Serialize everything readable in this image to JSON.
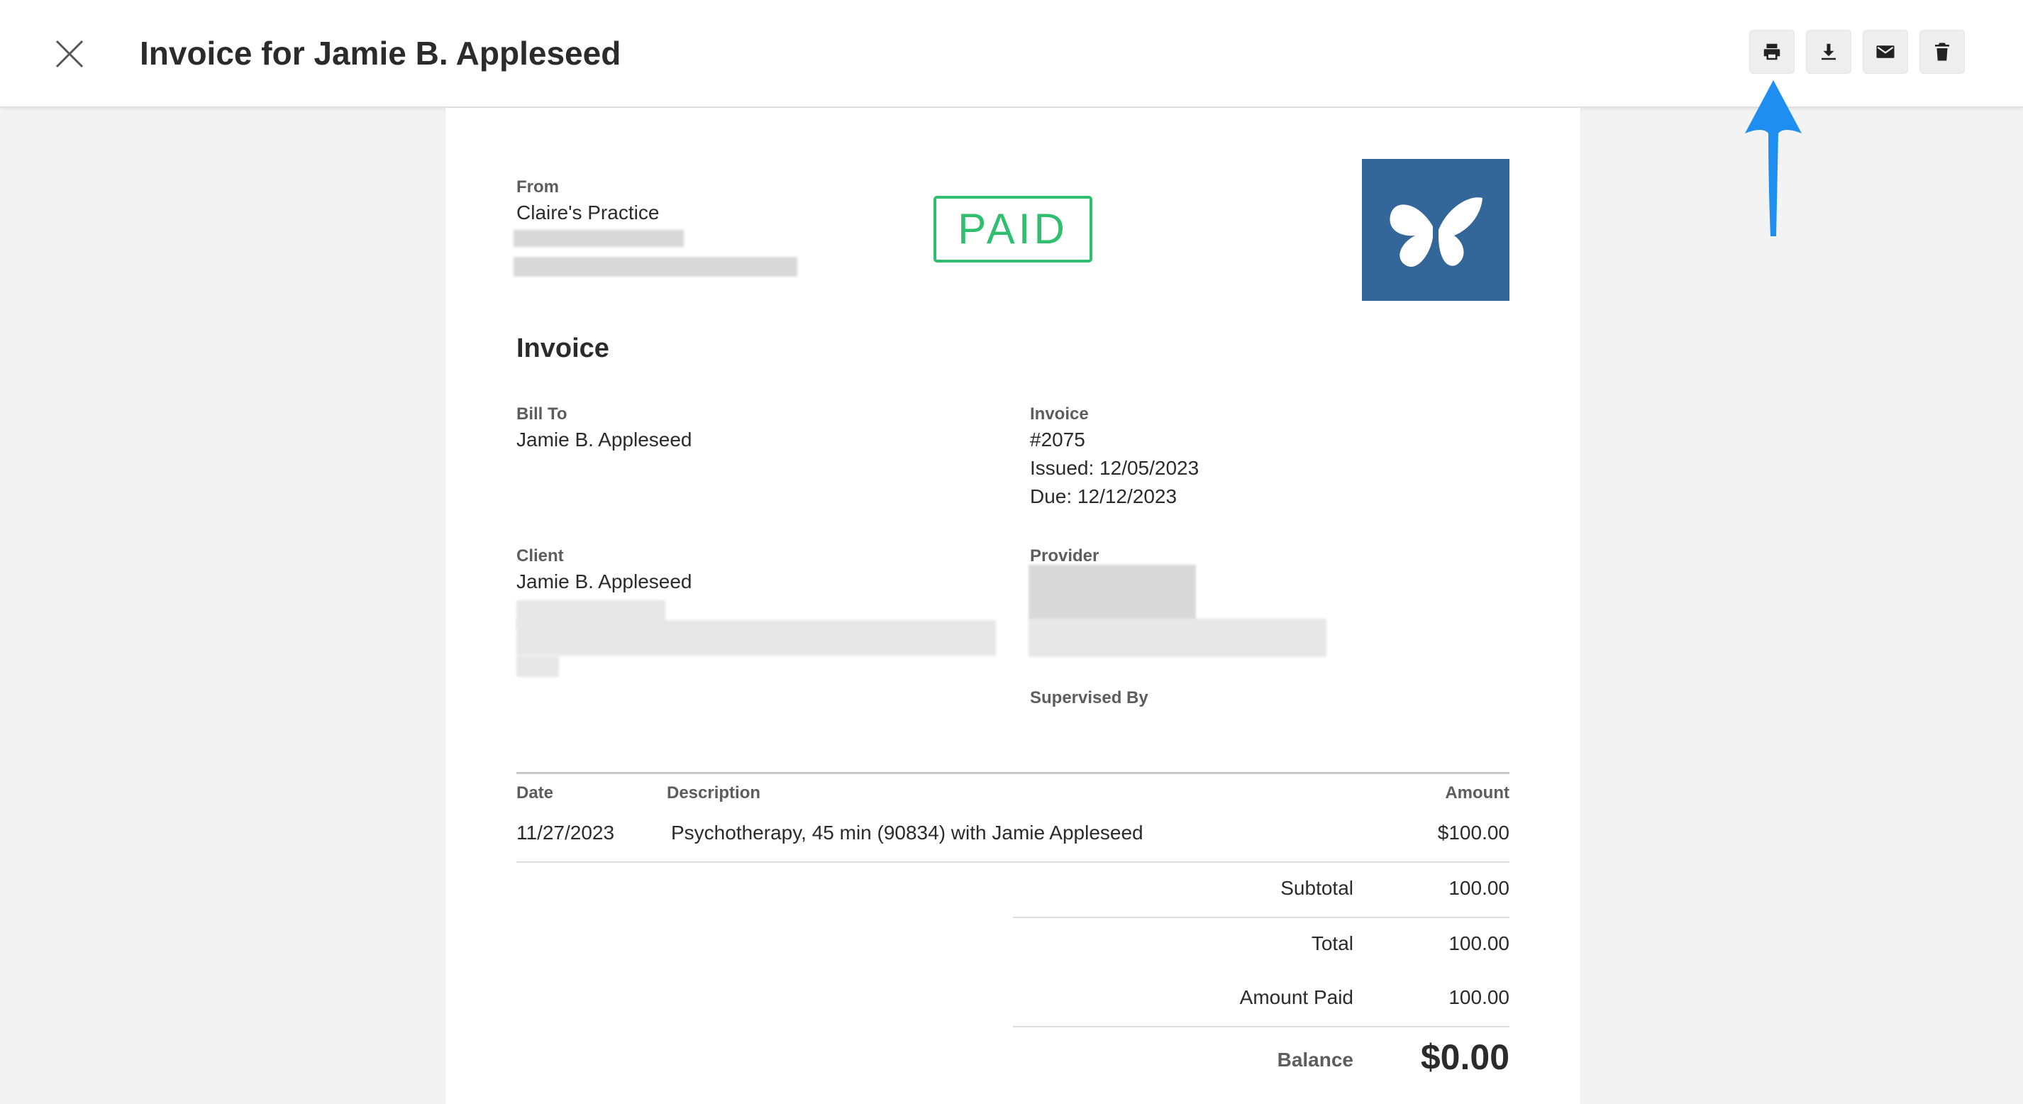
{
  "header": {
    "title": "Invoice for Jamie B. Appleseed",
    "actions": [
      {
        "name": "print",
        "icon": "printer-icon"
      },
      {
        "name": "download",
        "icon": "download-icon"
      },
      {
        "name": "email",
        "icon": "envelope-icon"
      },
      {
        "name": "delete",
        "icon": "trash-icon"
      }
    ]
  },
  "invoice": {
    "from_label": "From",
    "practice_name": "Claire's Practice",
    "status_stamp": "PAID",
    "heading": "Invoice",
    "bill_to_label": "Bill To",
    "bill_to_name": "Jamie B. Appleseed",
    "invoice_label": "Invoice",
    "invoice_number": "#2075",
    "issued": "Issued: 12/05/2023",
    "due": "Due: 12/12/2023",
    "client_label": "Client",
    "client_name": "Jamie B. Appleseed",
    "provider_label": "Provider",
    "supervised_by_label": "Supervised By",
    "columns": {
      "date": "Date",
      "description": "Description",
      "amount": "Amount"
    },
    "line_items": [
      {
        "date": "11/27/2023",
        "description": "Psychotherapy, 45 min (90834) with Jamie Appleseed",
        "amount": "$100.00"
      }
    ],
    "totals": {
      "subtotal_label": "Subtotal",
      "subtotal": "100.00",
      "total_label": "Total",
      "total": "100.00",
      "amount_paid_label": "Amount Paid",
      "amount_paid": "100.00",
      "balance_label": "Balance",
      "balance": "$0.00"
    }
  },
  "colors": {
    "paid_green": "#2fbf6f",
    "logo_blue": "#336699",
    "annotation_arrow": "#1e8ff0"
  }
}
